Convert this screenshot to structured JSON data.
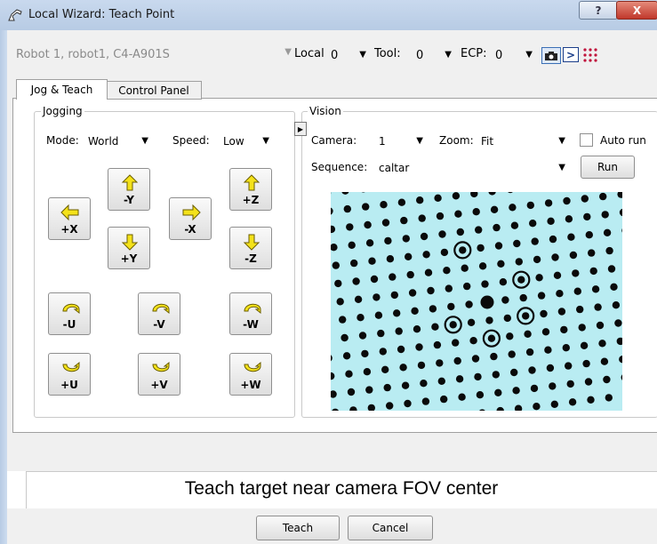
{
  "window": {
    "title": "Local Wizard: Teach Point",
    "help_label": "?",
    "close_label": "X"
  },
  "toolbar": {
    "robot": "Robot  1, robot1, C4-A901S",
    "local_label": "Local",
    "local_value": "0",
    "tool_label": "Tool:",
    "tool_value": "0",
    "ecp_label": "ECP:",
    "ecp_value": "0",
    "icons": [
      "camera-icon",
      "run-sequence-icon",
      "dot-grid-icon"
    ]
  },
  "tabs": [
    {
      "label": "Jog & Teach",
      "active": true
    },
    {
      "label": "Control Panel",
      "active": false
    }
  ],
  "jogging": {
    "group_label": "Jogging",
    "mode_label": "Mode:",
    "mode_value": "World",
    "speed_label": "Speed:",
    "speed_value": "Low",
    "buttons": {
      "minus_y": "-Y",
      "plus_x": "+X",
      "minus_x": "-X",
      "plus_y": "+Y",
      "plus_z": "+Z",
      "minus_z": "-Z",
      "minus_u": "-U",
      "minus_v": "-V",
      "minus_w": "-W",
      "plus_u": "+U",
      "plus_v": "+V",
      "plus_w": "+W"
    }
  },
  "vision": {
    "group_label": "Vision",
    "camera_label": "Camera:",
    "camera_value": "1",
    "zoom_label": "Zoom:",
    "zoom_value": "Fit",
    "auto_run_label": "Auto run",
    "auto_run_checked": false,
    "sequence_label": "Sequence:",
    "sequence_value": "caltar",
    "run_label": "Run"
  },
  "status": {
    "message": "Teach target near camera FOV center"
  },
  "buttons": {
    "teach": "Teach",
    "cancel": "Cancel"
  },
  "colors": {
    "arrow_yellow": "#f4e21a",
    "camera_bg": "#b9ecf2",
    "dot": "#0a0a0a"
  }
}
